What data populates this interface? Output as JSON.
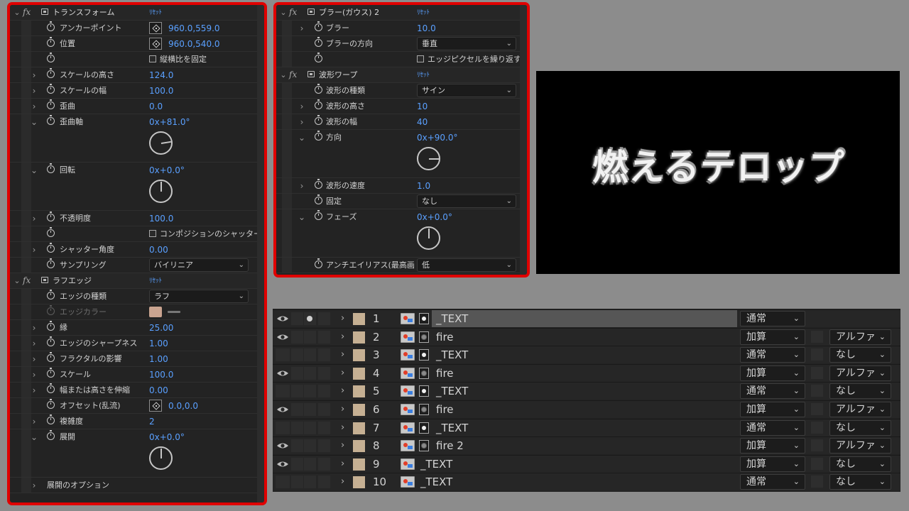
{
  "left_panel": {
    "effects": [
      {
        "name": "トランスフォーム",
        "reset": "ﾘｾｯﾄ",
        "props": [
          {
            "label": "アンカーポイント",
            "value": "960.0,559.0",
            "kind": "target"
          },
          {
            "label": "位置",
            "value": "960.0,540.0",
            "kind": "target"
          },
          {
            "label": "",
            "checkbox": "縦横比を固定",
            "kind": "checkbox"
          },
          {
            "label": "スケールの高さ",
            "value": "124.0",
            "kind": "value"
          },
          {
            "label": "スケールの幅",
            "value": "100.0",
            "kind": "value"
          },
          {
            "label": "歪曲",
            "value": "0.0",
            "kind": "value"
          },
          {
            "label": "歪曲軸",
            "value": "0x+81.0°",
            "kind": "dial",
            "angle_deg": 81
          },
          {
            "label": "回転",
            "value": "0x+0.0°",
            "kind": "dial",
            "angle_deg": 0
          },
          {
            "label": "不透明度",
            "value": "100.0",
            "kind": "value"
          },
          {
            "label": "",
            "checkbox": "コンポジションのシャッター",
            "kind": "checkbox"
          },
          {
            "label": "シャッター角度",
            "value": "0.00",
            "kind": "value"
          },
          {
            "label": "サンプリング",
            "select": "バイリニア",
            "kind": "select"
          }
        ]
      },
      {
        "name": "ラフエッジ",
        "reset": "ﾘｾｯﾄ",
        "props": [
          {
            "label": "エッジの種類",
            "select": "ラフ",
            "kind": "select"
          },
          {
            "label": "エッジカラー",
            "kind": "color",
            "color": "#caa490"
          },
          {
            "label": "縁",
            "value": "25.00",
            "kind": "value"
          },
          {
            "label": "エッジのシャープネス",
            "value": "1.00",
            "kind": "value"
          },
          {
            "label": "フラクタルの影響",
            "value": "1.00",
            "kind": "value"
          },
          {
            "label": "スケール",
            "value": "100.0",
            "kind": "value"
          },
          {
            "label": "幅または高さを伸縮",
            "value": "0.00",
            "kind": "value"
          },
          {
            "label": "オフセット(乱流)",
            "value": "0.0,0.0",
            "kind": "target"
          },
          {
            "label": "複雑度",
            "value": "2",
            "kind": "value"
          },
          {
            "label": "展開",
            "value": "0x+0.0°",
            "kind": "dial",
            "angle_deg": 0
          },
          {
            "label": "展開のオプション",
            "kind": "group"
          }
        ]
      }
    ]
  },
  "right_panel": {
    "effects": [
      {
        "name": "ブラー(ガウス) 2",
        "reset": "ﾘｾｯﾄ",
        "props": [
          {
            "label": "ブラー",
            "value": "10.0"
          },
          {
            "label": "ブラーの方向",
            "select": "垂直"
          },
          {
            "checkbox": "エッジピクセルを繰り返す"
          }
        ]
      },
      {
        "name": "波形ワープ",
        "reset": "ﾘｾｯﾄ",
        "props": [
          {
            "label": "波形の種類",
            "select": "サイン"
          },
          {
            "label": "波形の高さ",
            "value": "10"
          },
          {
            "label": "波形の幅",
            "value": "40"
          },
          {
            "label": "方向",
            "value": "0x+90.0°",
            "angle_deg": 90
          },
          {
            "label": "波形の速度",
            "value": "1.0"
          },
          {
            "label": "固定",
            "select": "なし"
          },
          {
            "label": "フェーズ",
            "value": "0x+0.0°",
            "angle_deg": 0
          },
          {
            "label": "アンチエイリアス(最高画",
            "select": "低"
          }
        ]
      }
    ]
  },
  "preview": {
    "text": "燃えるテロップ"
  },
  "timeline": {
    "layers": [
      {
        "num": "1",
        "name": "_TEXT",
        "visible": true,
        "solo": true,
        "matte": "solid",
        "mode": "通常",
        "trkmat": "",
        "selected": true
      },
      {
        "num": "2",
        "name": "fire",
        "visible": true,
        "solo": false,
        "matte": "noise",
        "mode": "加算",
        "trkmat": "アルファ"
      },
      {
        "num": "3",
        "name": "_TEXT",
        "visible": false,
        "solo": false,
        "matte": "solid",
        "mode": "通常",
        "trkmat": "なし"
      },
      {
        "num": "4",
        "name": "fire",
        "visible": true,
        "solo": false,
        "matte": "noise",
        "mode": "加算",
        "trkmat": "アルファ"
      },
      {
        "num": "5",
        "name": "_TEXT",
        "visible": false,
        "solo": false,
        "matte": "solid",
        "mode": "通常",
        "trkmat": "なし"
      },
      {
        "num": "6",
        "name": "fire",
        "visible": true,
        "solo": false,
        "matte": "noise",
        "mode": "加算",
        "trkmat": "アルファ"
      },
      {
        "num": "7",
        "name": "_TEXT",
        "visible": false,
        "solo": false,
        "matte": "solid",
        "mode": "通常",
        "trkmat": "なし"
      },
      {
        "num": "8",
        "name": "fire 2",
        "visible": true,
        "solo": false,
        "matte": "noise",
        "mode": "加算",
        "trkmat": "アルファ"
      },
      {
        "num": "9",
        "name": "_TEXT",
        "visible": true,
        "solo": false,
        "matte": "none",
        "mode": "加算",
        "trkmat": "なし"
      },
      {
        "num": "10",
        "name": "_TEXT",
        "visible": false,
        "solo": false,
        "matte": "none",
        "mode": "通常",
        "trkmat": "なし"
      }
    ]
  },
  "colors": {
    "highlight_border": "#e00000",
    "value_blue": "#5aa0ff",
    "layer_label": "#c6b093",
    "panel_bg": "#232323",
    "preview_bg": "#000000"
  }
}
